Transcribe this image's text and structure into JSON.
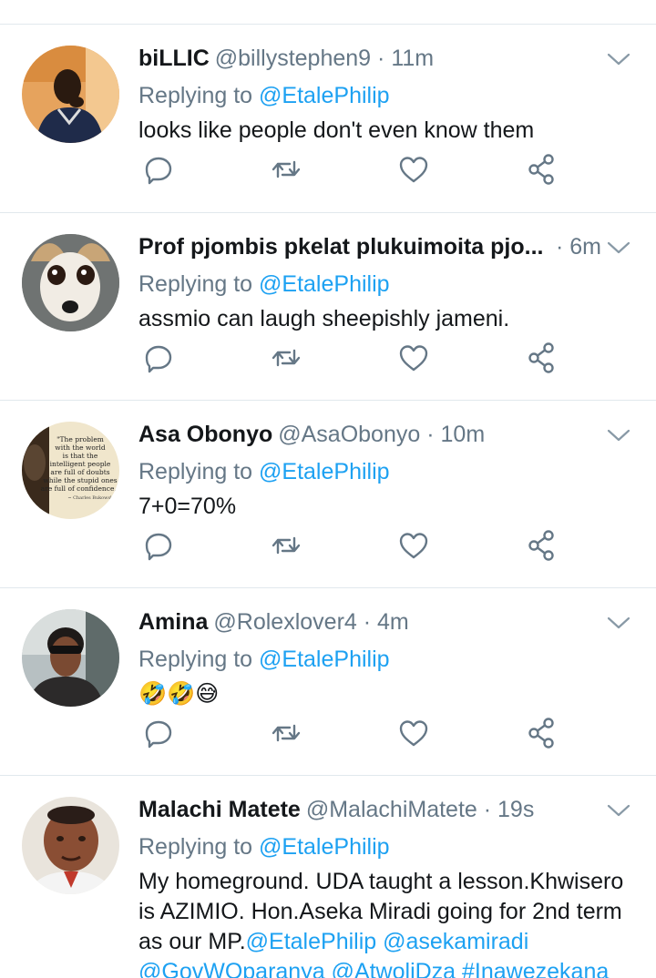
{
  "reply_prefix": "Replying to",
  "replying_to": "@EtalePhilip",
  "tweets": [
    {
      "name": "biLLIC",
      "handle": "@billystephen9",
      "time": "· 11m",
      "text": "looks like people don't even know them",
      "avatar": "person-avatar"
    },
    {
      "name": "Prof pjombis pkelat plukuimoita pjo...",
      "handle": "",
      "time": "· 6m",
      "text": "assmio can laugh sheepishly jameni.",
      "avatar": "dog-avatar"
    },
    {
      "name": "Asa Obonyo",
      "handle": "@AsaObonyo",
      "time": "· 10m",
      "text": "7+0=70%",
      "avatar": "quote-avatar",
      "avatar_quote": [
        "\"The problem",
        "with the world",
        "is that the",
        "intelligent people",
        "are full of doubts",
        "while the stupid ones",
        "are full of confidence.\"",
        "~ Charles Bukowski"
      ]
    },
    {
      "name": "Amina",
      "handle": "@Rolexlover4",
      "time": "· 4m",
      "text": "🤣🤣😅",
      "avatar": "woman-avatar"
    },
    {
      "name": "Malachi Matete",
      "handle": "@MalachiMatete",
      "time": "· 19s",
      "text_parts": [
        {
          "text": "My homeground. UDA taught a lesson.Khwisero is AZIMIO. Hon.Aseka Miradi going for 2nd term as our MP.",
          "mention": false
        },
        {
          "text": "@EtalePhilip @asekamiradi @GovWOparanya @AtwoliDza #Inawezekana",
          "mention": true
        }
      ],
      "avatar": "man-avatar"
    }
  ],
  "icons": {
    "reply": "reply-icon",
    "retweet": "retweet-icon",
    "like": "like-icon",
    "share": "share-icon",
    "more": "chevron-down-icon"
  },
  "colors": {
    "link": "#1da1f2",
    "secondary": "#657786",
    "text": "#14171a",
    "divider": "#e1e8ed"
  }
}
